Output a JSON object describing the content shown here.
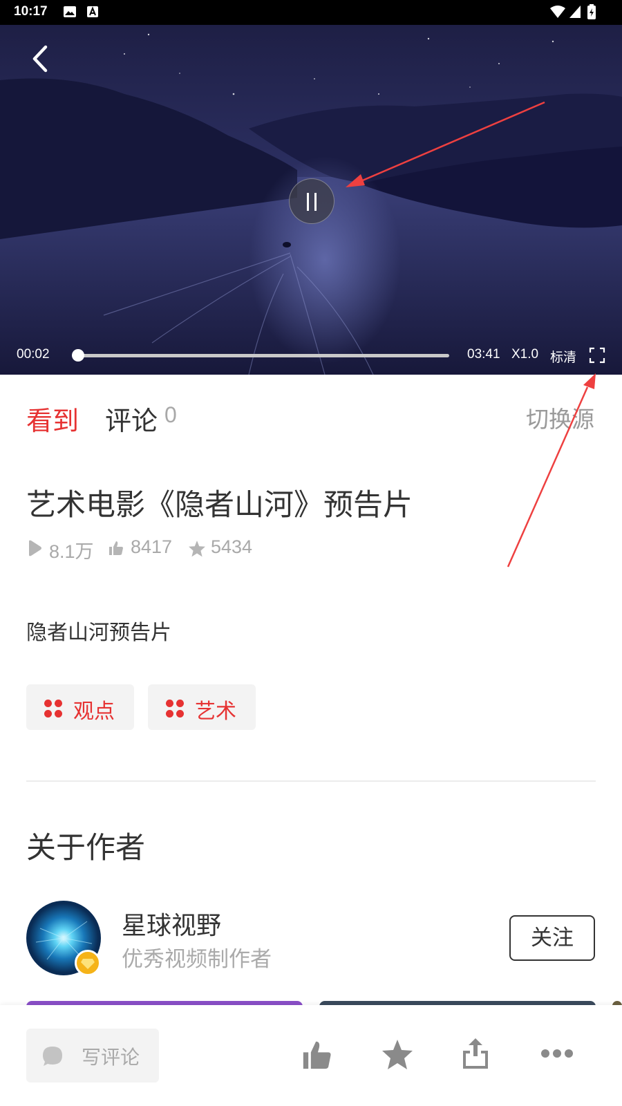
{
  "status_bar": {
    "time": "10:17"
  },
  "player": {
    "current_time": "00:02",
    "duration": "03:41",
    "progress": 0.009,
    "speed": "X1.0",
    "quality": "标清"
  },
  "tabs": {
    "watch": "看到",
    "comments": "评论",
    "comments_count": "0",
    "switch_source": "切换源"
  },
  "video": {
    "title": "艺术电影《隐者山河》预告片",
    "plays": "8.1万",
    "likes": "8417",
    "favorites": "5434",
    "description": "隐者山河预告片",
    "tags": [
      "观点",
      "艺术"
    ]
  },
  "author_section": {
    "heading": "关于作者",
    "name": "星球视野",
    "description": "优秀视频制作者",
    "follow_label": "关注"
  },
  "bottom_bar": {
    "comment_placeholder": "写评论"
  },
  "colors": {
    "accent": "#e63232",
    "muted": "#a9a9a9",
    "text": "#333333"
  },
  "icons": [
    "back-icon",
    "pause-icon",
    "fullscreen-icon",
    "play-count-icon",
    "thumb-up-icon",
    "star-icon",
    "tag-dots-icon",
    "comment-bubble-icon",
    "share-icon",
    "more-icon"
  ]
}
